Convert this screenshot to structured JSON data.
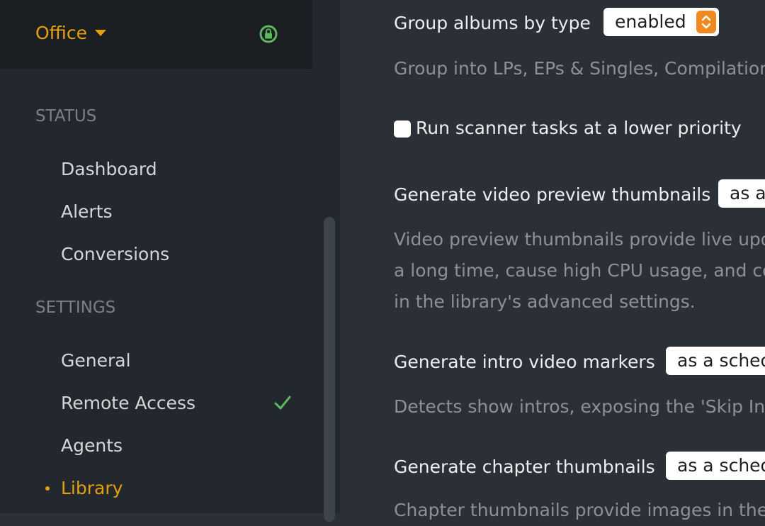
{
  "server": {
    "name": "Office"
  },
  "sidebar": {
    "status_heading": "STATUS",
    "status_items": [
      "Dashboard",
      "Alerts",
      "Conversions"
    ],
    "settings_heading": "SETTINGS",
    "settings_items": [
      "General",
      "Remote Access",
      "Agents",
      "Library"
    ],
    "active_item": "Library"
  },
  "settings": {
    "group_albums": {
      "label": "Group albums by type",
      "value": "enabled",
      "help": "Group into LPs, EPs & Singles, Compilations"
    },
    "low_priority": {
      "label": "Run scanner tasks at a lower priority",
      "checked": false
    },
    "video_preview": {
      "label": "Generate video preview thumbnails",
      "value": "as a",
      "help_lines": [
        "Video preview thumbnails provide live upda",
        "a long time, cause high CPU usage, and con",
        "in the library's advanced settings."
      ]
    },
    "intro_markers": {
      "label": "Generate intro video markers",
      "value": "as a sched",
      "help": "Detects show intros, exposing the 'Skip Intr"
    },
    "chapter_thumbnails": {
      "label": "Generate chapter thumbnails",
      "value": "as a sched",
      "help": "Chapter thumbnails provide images in the c"
    }
  },
  "colors": {
    "accent": "#e5a00d",
    "success": "#5cb85c",
    "select_arrow": "#f1891e"
  },
  "icons": {
    "server_dropdown": "caret-down-icon",
    "secure": "lock-icon",
    "remote_access_ok": "checkmark-icon"
  }
}
